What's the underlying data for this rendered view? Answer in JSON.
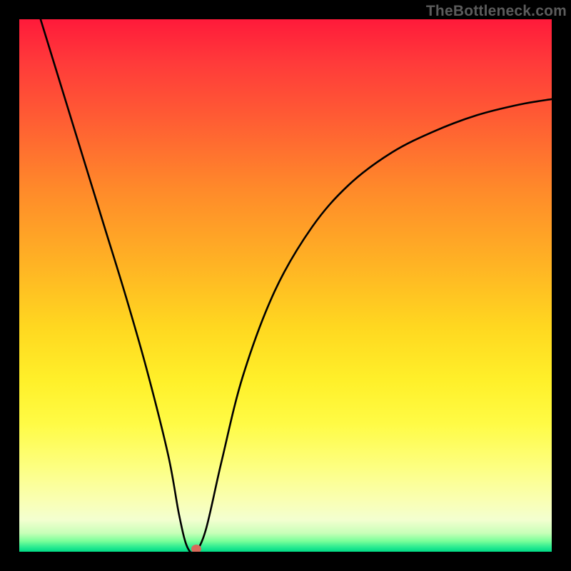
{
  "watermark": "TheBottleneck.com",
  "chart_data": {
    "type": "line",
    "title": "",
    "xlabel": "",
    "ylabel": "",
    "xlim": [
      0,
      100
    ],
    "ylim": [
      0,
      100
    ],
    "grid": false,
    "legend": false,
    "series": [
      {
        "name": "bottleneck-curve",
        "x": [
          4,
          8,
          12,
          16,
          20,
          24,
          28,
          30,
          31.5,
          33,
          35,
          38,
          42,
          48,
          55,
          62,
          70,
          78,
          86,
          94,
          100
        ],
        "values": [
          100,
          87,
          74,
          61,
          48,
          34,
          18,
          7,
          1,
          0,
          4,
          17,
          33,
          49,
          61,
          69,
          75,
          79,
          82,
          84,
          85
        ]
      }
    ],
    "marker": {
      "x": 33.2,
      "y": 0.5,
      "color": "#d86a5a"
    },
    "background_gradient": {
      "top": "#ff1a3a",
      "mid": "#ffd820",
      "bottom": "#00d884"
    }
  }
}
